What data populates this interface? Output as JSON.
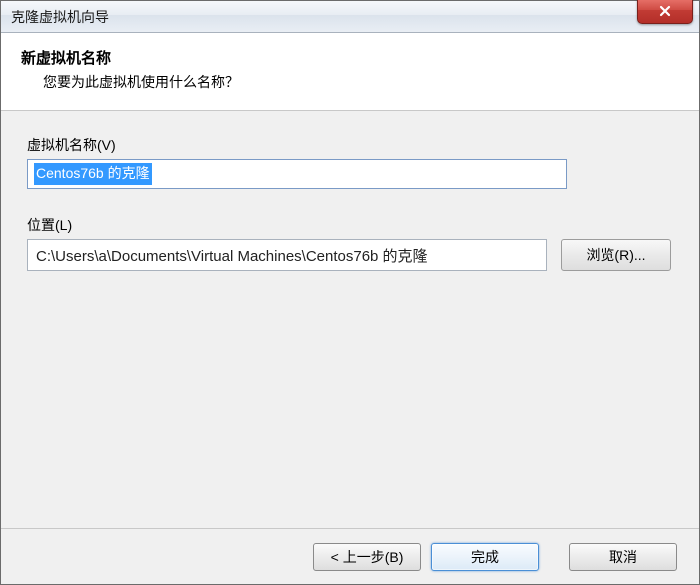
{
  "titlebar": {
    "title": "克隆虚拟机向导"
  },
  "header": {
    "title": "新虚拟机名称",
    "subtitle": "您要为此虚拟机使用什么名称？"
  },
  "fields": {
    "name_label": "虚拟机名称(V)",
    "name_value": "Centos76b 的克隆",
    "location_label": "位置(L)",
    "location_value": "C:\\Users\\a\\Documents\\Virtual Machines\\Centos76b 的克隆",
    "browse_label": "浏览(R)..."
  },
  "footer": {
    "back_label": "< 上一步(B)",
    "finish_label": "完成",
    "cancel_label": "取消"
  }
}
